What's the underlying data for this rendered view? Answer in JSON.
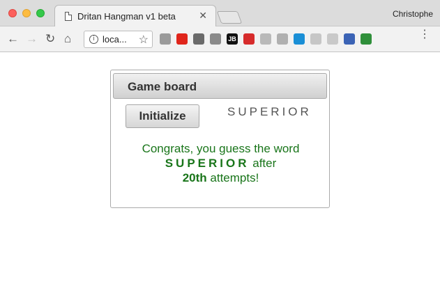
{
  "window": {
    "profile_name": "Christophe"
  },
  "tab": {
    "title": "Dritan Hangman v1 beta",
    "close_glyph": "✕"
  },
  "toolbar": {
    "back_glyph": "←",
    "forward_glyph": "→",
    "reload_glyph": "↻",
    "home_glyph": "⌂",
    "url": "loca...",
    "info_glyph": "i",
    "star_glyph": "☆",
    "menu_glyph": "⋮",
    "extensions": [
      {
        "name": "camera-icon",
        "color": "#9a9a9a"
      },
      {
        "name": "opera-icon",
        "color": "#e0251b"
      },
      {
        "name": "recycle-icon",
        "color": "#6a6a6a"
      },
      {
        "name": "p-icon",
        "color": "#8a8a8a"
      },
      {
        "name": "jetbrains-icon",
        "color": "#111111",
        "label": "JB"
      },
      {
        "name": "fast-forward-icon",
        "color": "#d62b2b"
      },
      {
        "name": "copy-icon",
        "color": "#b9b9b9"
      },
      {
        "name": "dropbox-icon",
        "color": "#b0b0b0"
      },
      {
        "name": "edge-icon",
        "color": "#1a8fd6"
      },
      {
        "name": "circle-icon",
        "color": "#c6c6c6"
      },
      {
        "name": "feather-icon",
        "color": "#c9c9c9"
      },
      {
        "name": "bookmark-icon",
        "color": "#3b63b5"
      },
      {
        "name": "cube-icon",
        "color": "#2f8f3a"
      }
    ]
  },
  "game": {
    "panel_title": "Game board",
    "initialize_label": "Initialize",
    "word_display": "SUPERIOR",
    "message": {
      "part1": "Congrats, you guess the word",
      "word": "SUPERIOR",
      "part2": "after",
      "attempts": "20th",
      "part3": "attempts!"
    }
  },
  "colors": {
    "message_green": "#19751a",
    "panel_border": "#aaaaaa"
  }
}
